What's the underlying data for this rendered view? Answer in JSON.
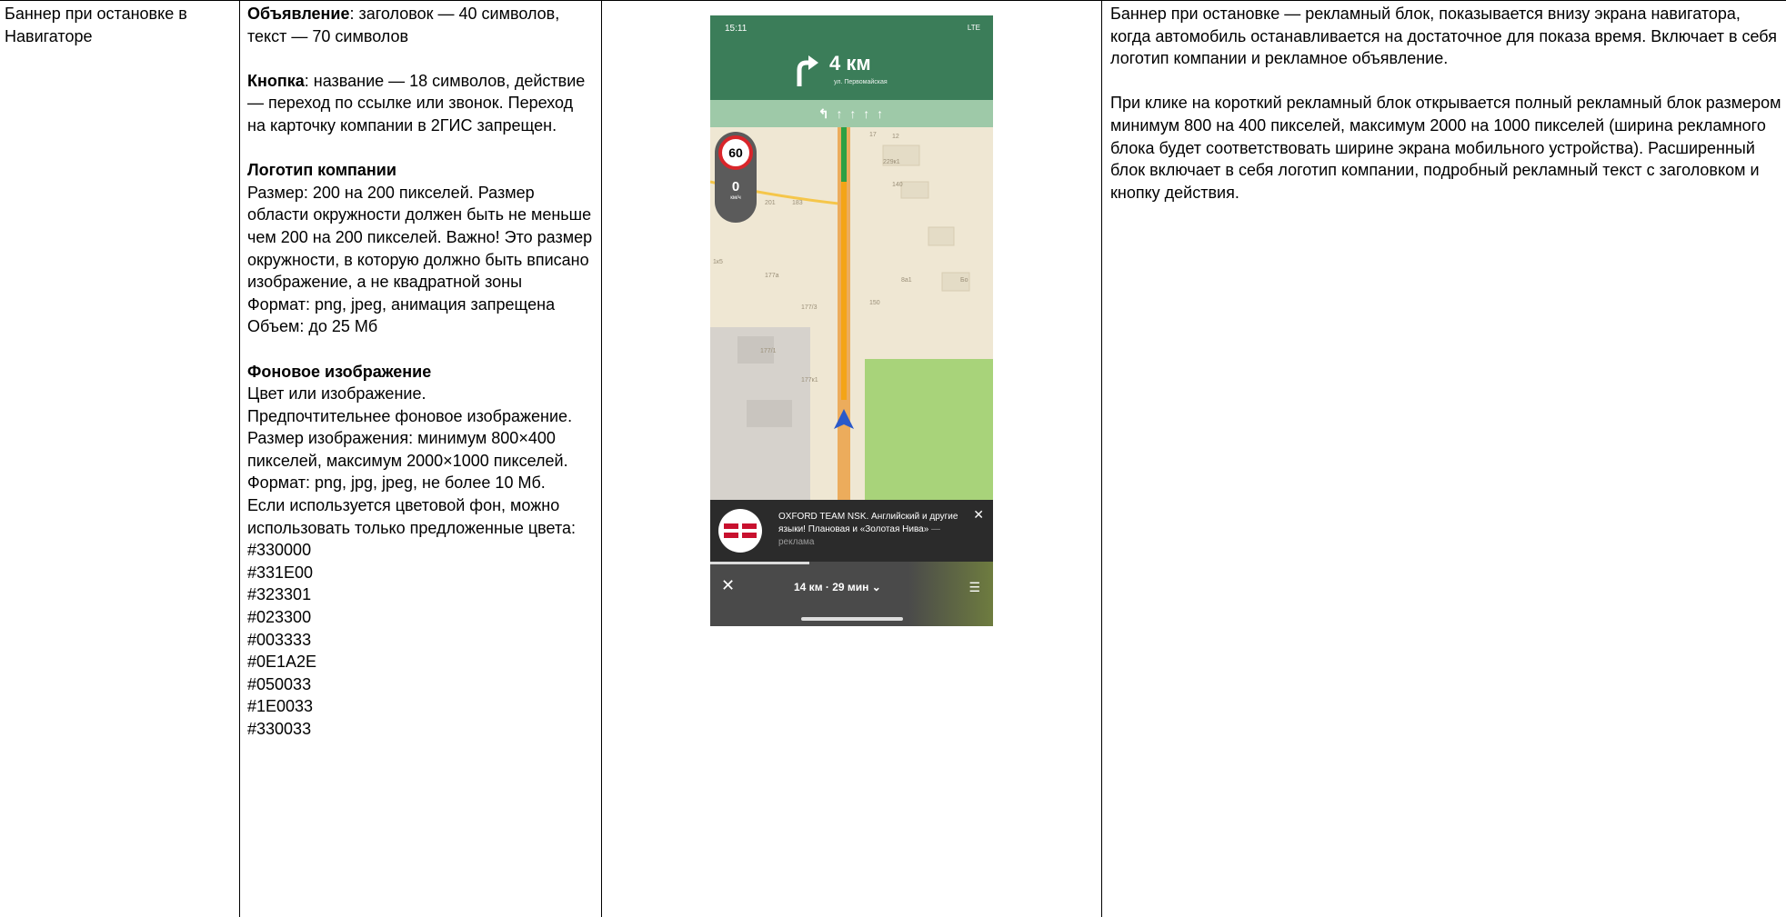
{
  "col1": {
    "title": "Баннер при остановке в Навигаторе"
  },
  "col2": {
    "ad": {
      "label": "Объявление",
      "text": ": заголовок — 40 символов, текст — 70 символов"
    },
    "button": {
      "label": "Кнопка",
      "text": ": название — 18 символов, действие — переход по ссылке или звонок. Переход на карточку компании в 2ГИС запрещен."
    },
    "logo": {
      "title": "Логотип компании",
      "lines": [
        "Размер: 200 на 200 пикселей. Размер области окружности должен быть не меньше чем 200 на 200 пикселей. Важно! Это размер окружности, в которую должно быть вписано изображение, а не квадратной зоны",
        "Формат: png, jpeg, анимация запрещена",
        "Объем: до 25 Мб"
      ]
    },
    "background": {
      "title": "Фоновое изображение",
      "lines": [
        "Цвет или изображение.",
        "Предпочтительнее фоновое изображение.",
        "Размер изображения: минимум 800×400 пикселей, максимум 2000×1000 пикселей.",
        "Формат: png, jpg, jpeg, не более 10 Мб.",
        "Если используется цветовой фон, можно использовать только предложенные цвета:"
      ],
      "colors": [
        "#330000",
        "#331E00",
        "#323301",
        "#023300",
        "#003333",
        "#0E1A2E",
        "#050033",
        "#1E0033",
        "#330033"
      ]
    }
  },
  "phone": {
    "time": "15:11",
    "network": "LTE",
    "distance": "4 км",
    "street": "ул. Первомайская",
    "speed_limit": "60",
    "speed_current": "0",
    "speed_unit": "км/ч",
    "map_labels": [
      "17",
      "12",
      "229к1",
      "140",
      "201",
      "183",
      "177а",
      "177/3",
      "177к1",
      "177/1",
      "150",
      "8а1",
      "Бо",
      "1к5"
    ],
    "ad_text": "OXFORD TEAM NSK. Английский и другие языки! Плановая и «Золотая Нива»",
    "ad_tag": " — реклама",
    "route_info": "14 км · 29 мин",
    "progress": 0.35,
    "accent": "#3b7d59"
  },
  "col4": {
    "paragraphs": [
      "Баннер при остановке — рекламный блок, показывается внизу экрана навигатора, когда автомобиль останавливается на достаточное для показа время. Включает в себя логотип компании и рекламное объявление.",
      "При клике на короткий рекламный блок открывается полный рекламный блок размером минимум 800 на 400 пикселей, максимум 2000 на 1000 пикселей (ширина рекламного блока будет соответствовать ширине экрана мобильного устройства). Расширенный блок включает в себя логотип компании, подробный рекламный текст с заголовком и кнопку действия."
    ]
  }
}
